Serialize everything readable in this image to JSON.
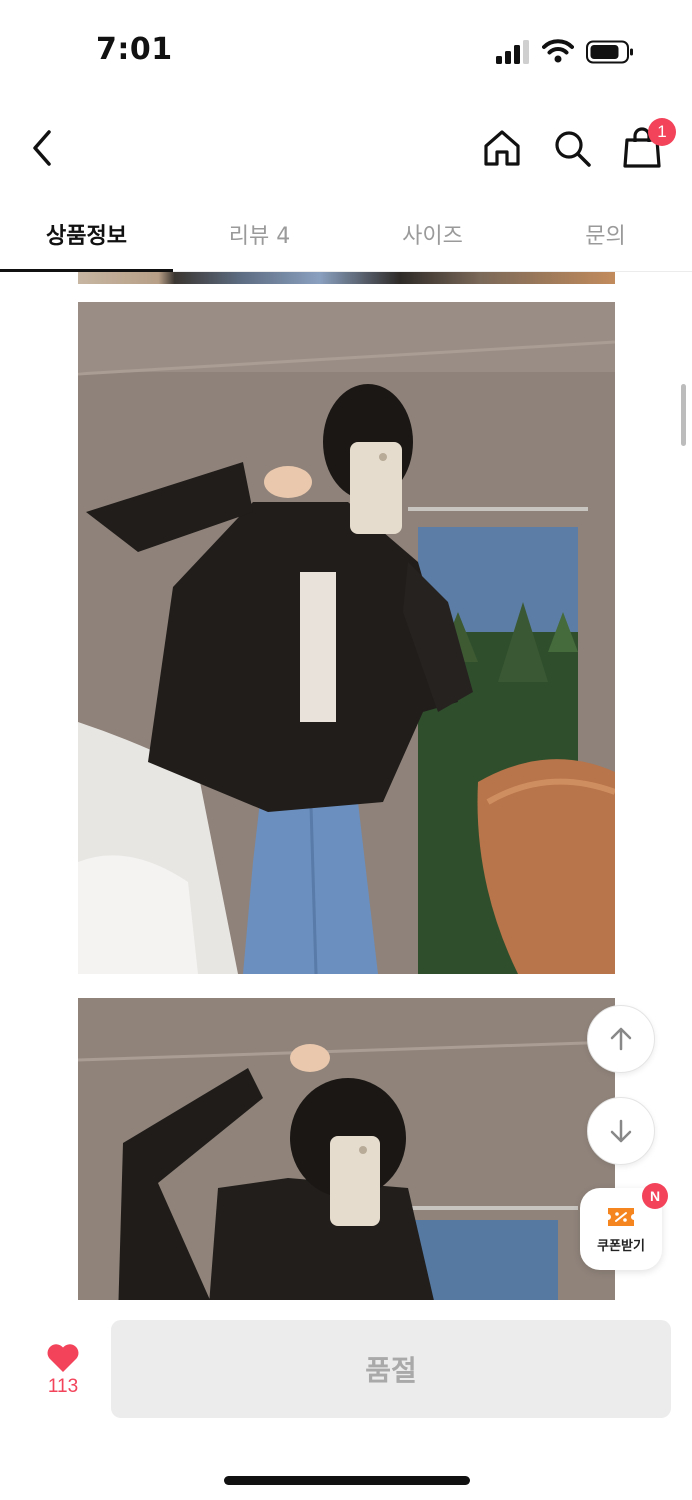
{
  "status_bar": {
    "time": "7:01",
    "icons": [
      "cellular-signal-icon",
      "wifi-icon",
      "battery-icon"
    ]
  },
  "header": {
    "icons": [
      "back-arrow-icon",
      "home-icon",
      "search-icon",
      "shopping-bag-icon"
    ],
    "cart_count": "1"
  },
  "tabs": [
    {
      "label": "상품정보",
      "active": true
    },
    {
      "label": "리뷰 4",
      "active": false
    },
    {
      "label": "사이즈",
      "active": false
    },
    {
      "label": "문의",
      "active": false
    }
  ],
  "content": {
    "images": [
      "product-photo-black-leather-jacket-mirror-selfie",
      "product-photo-black-leather-jacket-arm-raised"
    ]
  },
  "floating": {
    "scroll_up_icon": "arrow-up-icon",
    "scroll_down_icon": "arrow-down-icon",
    "coupon_label": "쿠폰받기",
    "coupon_badge": "N"
  },
  "bottom_bar": {
    "like_count": "113",
    "buy_label": "품절"
  },
  "colors": {
    "accent": "#f2435a",
    "coupon_icon": "#f5851f",
    "disabled_button": "#ececec"
  }
}
